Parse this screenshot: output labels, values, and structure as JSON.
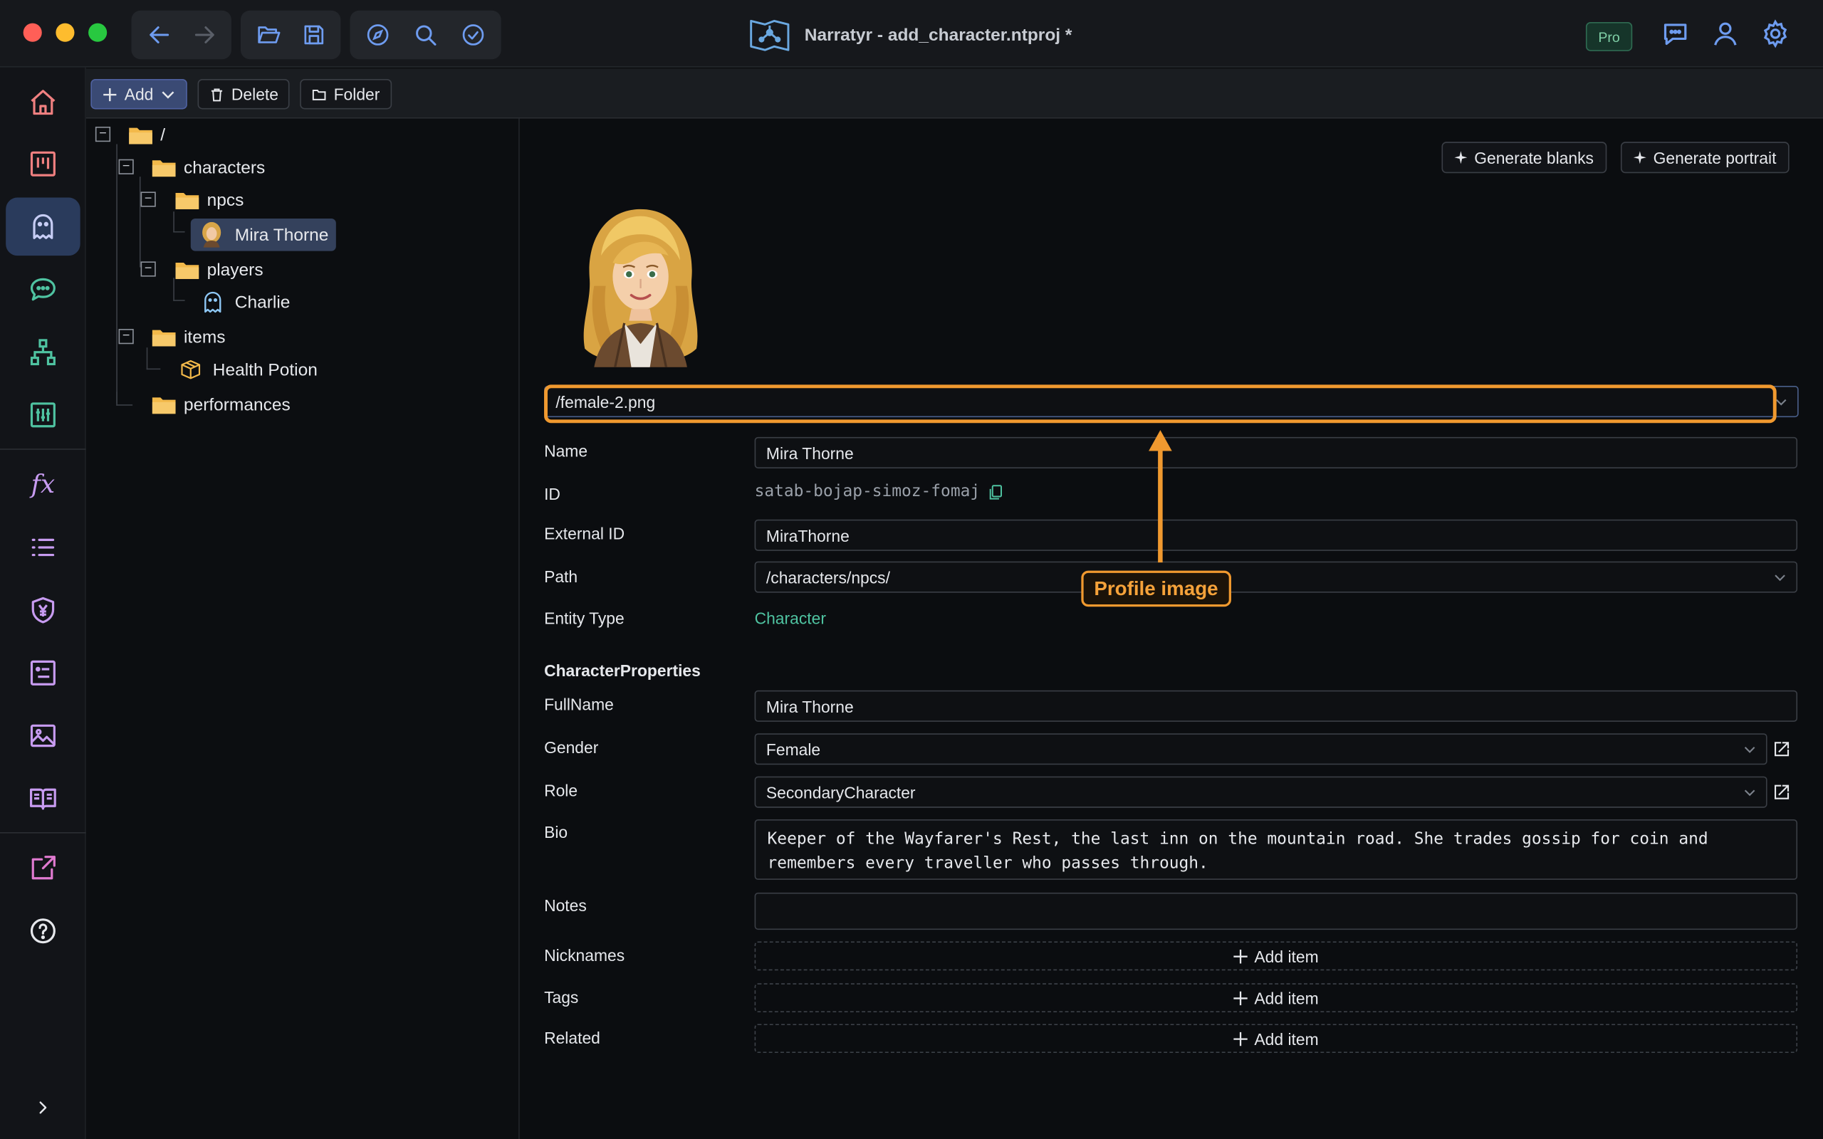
{
  "window": {
    "title": "Narratyr - add_character.ntproj *",
    "pro_badge": "Pro"
  },
  "toolbar": {
    "add_label": "Add",
    "delete_label": "Delete",
    "folder_label": "Folder"
  },
  "tree": {
    "root": "/",
    "characters": "characters",
    "npcs": "npcs",
    "mira": "Mira Thorne",
    "players": "players",
    "charlie": "Charlie",
    "items": "items",
    "health_potion": "Health Potion",
    "performances": "performances"
  },
  "editor": {
    "generate_blanks": "Generate blanks",
    "generate_portrait": "Generate portrait",
    "image_path": "/female-2.png",
    "labels": {
      "name": "Name",
      "id": "ID",
      "external_id": "External ID",
      "path": "Path",
      "entity_type": "Entity Type",
      "section": "CharacterProperties",
      "fullname": "FullName",
      "gender": "Gender",
      "role": "Role",
      "bio": "Bio",
      "notes": "Notes",
      "nicknames": "Nicknames",
      "tags": "Tags",
      "related": "Related"
    },
    "values": {
      "name": "Mira Thorne",
      "id": "satab-bojap-simoz-fomaj",
      "external_id": "MiraThorne",
      "path": "/characters/npcs/",
      "entity_type": "Character",
      "fullname": "Mira Thorne",
      "gender": "Female",
      "role": "SecondaryCharacter",
      "bio": "Keeper of the Wayfarer's Rest, the last inn on the mountain road. She trades gossip for coin and remembers every traveller who passes through.",
      "notes": ""
    },
    "add_item_label": "Add item"
  },
  "callout": {
    "label": "Profile image",
    "color": "#f0992f"
  }
}
